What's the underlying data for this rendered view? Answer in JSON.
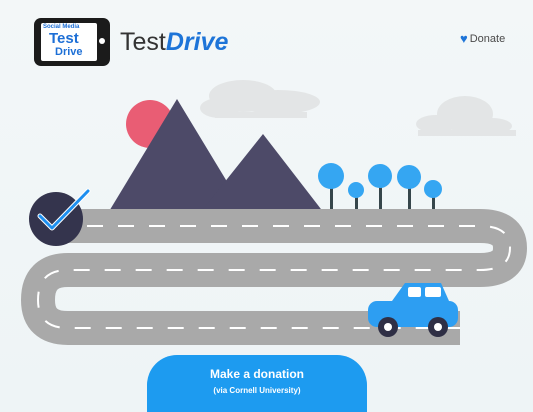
{
  "app": {
    "logo_text_small": "Social Media",
    "logo_text_test": "Test",
    "logo_text_drive": "Drive",
    "title_part_a": "Test",
    "title_part_b": "Drive"
  },
  "header": {
    "donate_label": "Donate",
    "heart_icon": "heart-icon"
  },
  "cta": {
    "label": "Make a donation",
    "sublabel": "(via Cornell University)"
  },
  "colors": {
    "accent": "#1d74d8",
    "button": "#1d9bf0",
    "mountain": "#4d4a68",
    "sun": "#e95d74",
    "road": "#a9a9a9",
    "tree": "#35a6f2",
    "car": "#2d9ef2",
    "checkmark_badge": "#34344d",
    "cloud": "#dddddd"
  }
}
